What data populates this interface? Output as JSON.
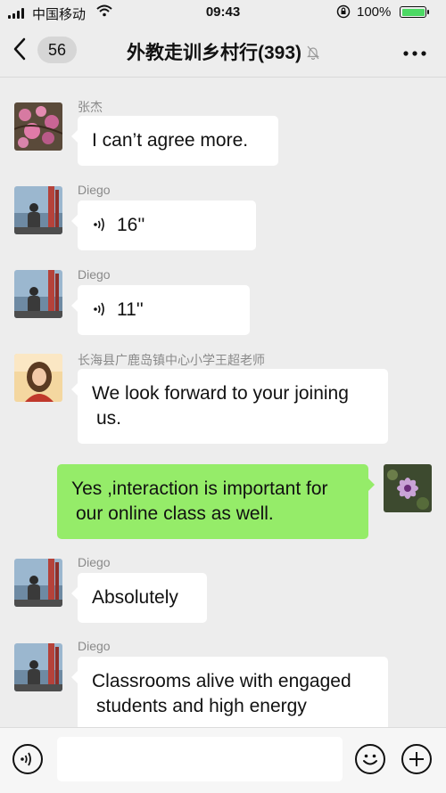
{
  "status_bar": {
    "carrier": "中国移动",
    "time": "09:43",
    "battery": "100%"
  },
  "nav": {
    "unread_count": "56",
    "title": "外教走训乡村行(393)"
  },
  "messages": [
    {
      "sender": "张杰",
      "text": "I can’t agree more."
    },
    {
      "sender": "Diego",
      "voice": "16''"
    },
    {
      "sender": "Diego",
      "voice": "11''"
    },
    {
      "sender": "长海县广鹿岛镇中心小学王超老师",
      "lines": [
        "We look forward to your joining",
        "us."
      ]
    },
    {
      "self": true,
      "lines": [
        "Yes ,interaction is important for",
        "our online class as well."
      ]
    },
    {
      "sender": "Diego",
      "text": "Absolutely"
    },
    {
      "sender": "Diego",
      "lines": [
        "Classrooms alive with engaged",
        "students and high energy"
      ]
    }
  ],
  "icons": {
    "back": "chevron-left-icon",
    "mute": "bell-slash-icon",
    "more": "more-dots-icon",
    "voice_toggle": "voice-icon",
    "emoji": "emoji-icon",
    "add": "plus-icon"
  },
  "colors": {
    "background": "#ededed",
    "self_bubble": "#95ec69",
    "other_bubble": "#ffffff"
  }
}
